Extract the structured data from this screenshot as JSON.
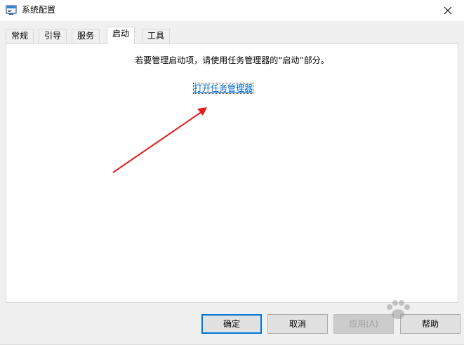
{
  "window": {
    "title": "系统配置",
    "app_icon": "msconfig-icon",
    "close_icon": "close-icon"
  },
  "tabs": [
    {
      "label": "常规",
      "active": false
    },
    {
      "label": "引导",
      "active": false
    },
    {
      "label": "服务",
      "active": false
    },
    {
      "label": "启动",
      "active": true
    },
    {
      "label": "工具",
      "active": false
    }
  ],
  "startup_panel": {
    "message": "若要管理启动项，请使用任务管理器的“启动”部分。",
    "link_text": "打开任务管理器"
  },
  "annotation": {
    "arrow_color": "#e02020"
  },
  "buttons": {
    "ok": "确定",
    "cancel": "取消",
    "apply": "应用(A)",
    "help": "帮助"
  },
  "colors": {
    "link": "#0066cc",
    "default_button_border": "#0078d7"
  }
}
